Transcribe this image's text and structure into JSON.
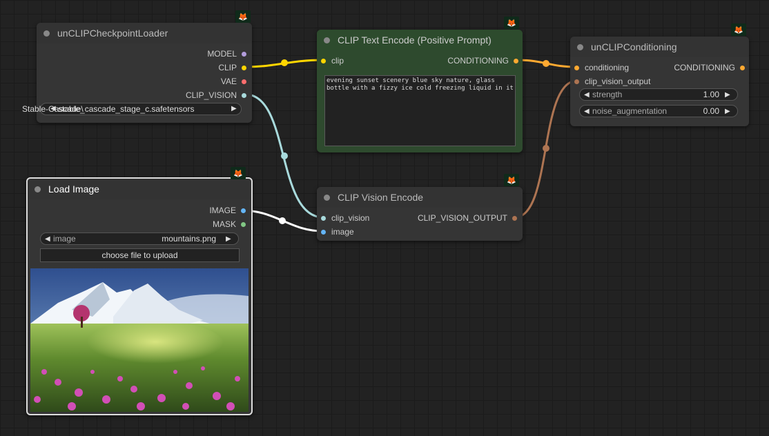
{
  "badge_icon": "fox-icon",
  "nodes": {
    "checkpoint_loader": {
      "title": "unCLIPCheckpointLoader",
      "outputs": [
        "MODEL",
        "CLIP",
        "VAE",
        "CLIP_VISION"
      ],
      "ckpt_widget": {
        "label": "Stable-Cascade\\",
        "value": "stable_cascade_stage_c.safetensors"
      }
    },
    "clip_text_encode": {
      "title": "CLIP Text Encode (Positive Prompt)",
      "input": "clip",
      "output": "CONDITIONING",
      "text": "evening sunset scenery blue sky nature, glass bottle with a fizzy ice cold freezing liquid in it"
    },
    "unclip_conditioning": {
      "title": "unCLIPConditioning",
      "inputs": [
        "conditioning",
        "clip_vision_output"
      ],
      "output": "CONDITIONING",
      "widgets": [
        {
          "label": "strength",
          "value": "1.00"
        },
        {
          "label": "noise_augmentation",
          "value": "0.00"
        }
      ]
    },
    "load_image": {
      "title": "Load Image",
      "outputs": [
        "IMAGE",
        "MASK"
      ],
      "image_widget": {
        "label": "image",
        "value": "mountains.png"
      },
      "upload_label": "choose file to upload"
    },
    "clip_vision_encode": {
      "title": "CLIP Vision Encode",
      "inputs": [
        "clip_vision",
        "image"
      ],
      "output": "CLIP_VISION_OUTPUT"
    }
  },
  "colors": {
    "clip": "#ffd500",
    "clip_vision": "#a8dadc",
    "conditioning": "#ffa931",
    "clip_vision_output": "#ad7452",
    "image": "#64b5f6",
    "mask": "#81c784",
    "model": "#b39ddb",
    "vae": "#ff6e6e",
    "positive_node": "#2e4a2e"
  }
}
